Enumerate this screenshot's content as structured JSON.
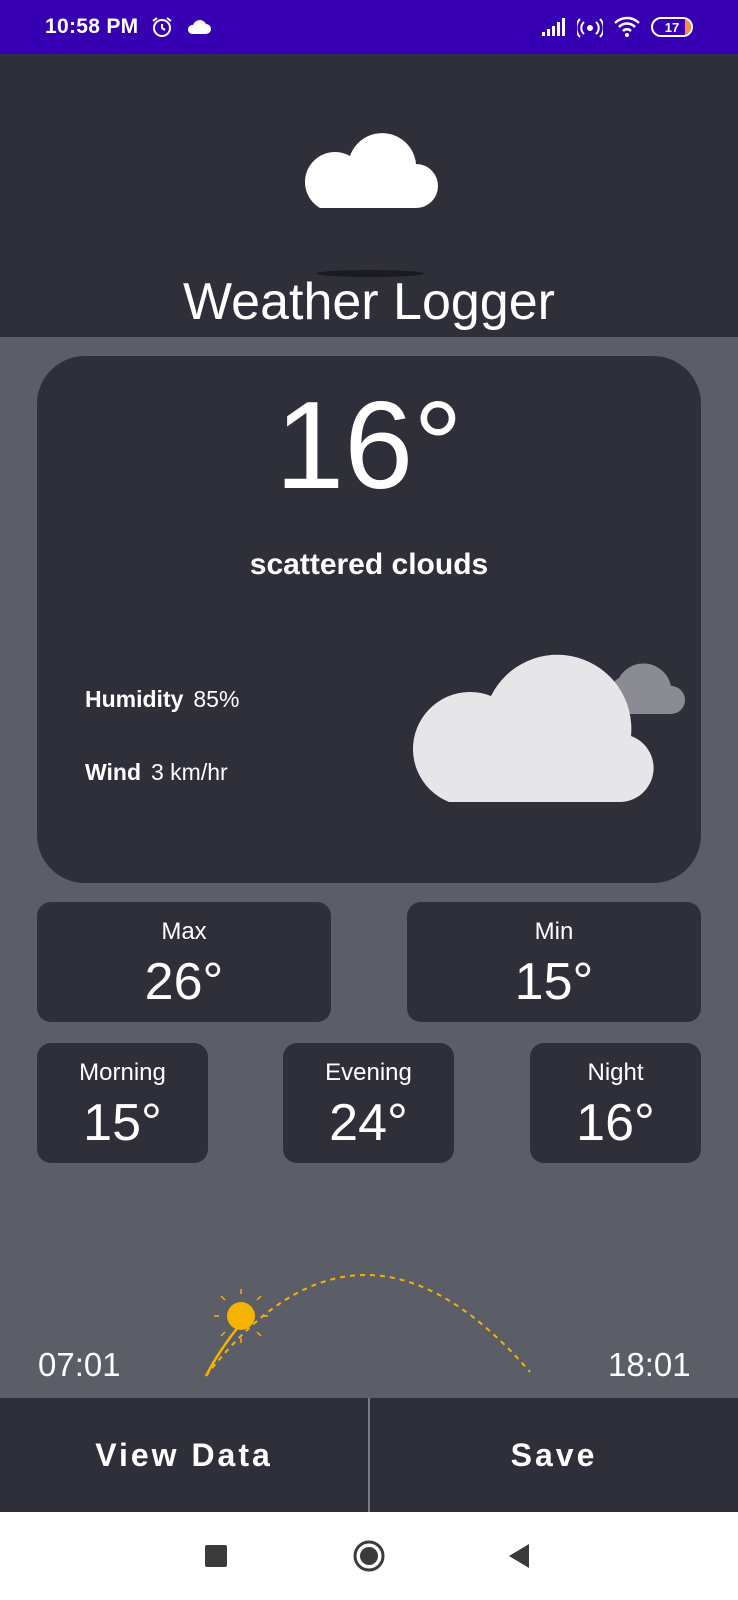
{
  "status_bar": {
    "time": "10:58 PM",
    "battery": "17"
  },
  "header": {
    "title": "Weather Logger"
  },
  "current": {
    "temperature": "16°",
    "description": "scattered clouds",
    "humidity_label": "Humidity",
    "humidity_value": "85%",
    "wind_label": "Wind",
    "wind_value": "3 km/hr"
  },
  "tiles": {
    "max_label": "Max",
    "max_value": "26°",
    "min_label": "Min",
    "min_value": "15°",
    "morning_label": "Morning",
    "morning_value": "15°",
    "evening_label": "Evening",
    "evening_value": "24°",
    "night_label": "Night",
    "night_value": "16°"
  },
  "sun": {
    "sunrise": "07:01",
    "sunset": "18:01"
  },
  "actions": {
    "view_data": "View Data",
    "save": "Save"
  },
  "colors": {
    "status_bar": "#3700b3",
    "card_bg": "#2e2f39",
    "page_bg": "#5b5d67",
    "sun": "#f5b300"
  },
  "icons": [
    "alarm-icon",
    "cloud-icon",
    "signal-icon",
    "hotspot-icon",
    "wifi-icon",
    "battery-icon",
    "weather-cloud-icon",
    "scattered-clouds-icon",
    "sun-icon",
    "stop-square-icon",
    "home-circle-icon",
    "back-triangle-icon"
  ]
}
